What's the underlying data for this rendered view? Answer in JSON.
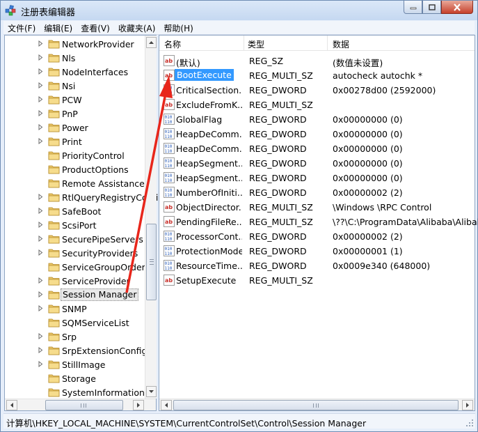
{
  "window": {
    "title": "注册表编辑器",
    "colors": {
      "titlebar": "#c5d8f1",
      "selection": "#3399ff",
      "annotation_arrow": "#e8261b"
    }
  },
  "menu": [
    {
      "label": "文件(F)"
    },
    {
      "label": "编辑(E)"
    },
    {
      "label": "查看(V)"
    },
    {
      "label": "收藏夹(A)"
    },
    {
      "label": "帮助(H)"
    }
  ],
  "tree": {
    "items": [
      {
        "label": "NetworkProvider",
        "expandable": true
      },
      {
        "label": "Nls",
        "expandable": true
      },
      {
        "label": "NodeInterfaces",
        "expandable": true
      },
      {
        "label": "Nsi",
        "expandable": true
      },
      {
        "label": "PCW",
        "expandable": true
      },
      {
        "label": "PnP",
        "expandable": true
      },
      {
        "label": "Power",
        "expandable": true
      },
      {
        "label": "Print",
        "expandable": true
      },
      {
        "label": "PriorityControl",
        "expandable": false
      },
      {
        "label": "ProductOptions",
        "expandable": false
      },
      {
        "label": "Remote Assistance",
        "expandable": false
      },
      {
        "label": "RtlQueryRegistryConfig",
        "expandable": true
      },
      {
        "label": "SafeBoot",
        "expandable": true
      },
      {
        "label": "ScsiPort",
        "expandable": true
      },
      {
        "label": "SecurePipeServers",
        "expandable": true
      },
      {
        "label": "SecurityProviders",
        "expandable": true
      },
      {
        "label": "ServiceGroupOrder",
        "expandable": false
      },
      {
        "label": "ServiceProvider",
        "expandable": true
      },
      {
        "label": "Session Manager",
        "expandable": true,
        "selected": true
      },
      {
        "label": "SNMP",
        "expandable": true
      },
      {
        "label": "SQMServiceList",
        "expandable": false
      },
      {
        "label": "Srp",
        "expandable": true
      },
      {
        "label": "SrpExtensionConfig",
        "expandable": true
      },
      {
        "label": "StillImage",
        "expandable": true
      },
      {
        "label": "Storage",
        "expandable": false
      },
      {
        "label": "SystemInformation",
        "expandable": false
      }
    ]
  },
  "list": {
    "columns": [
      "名称",
      "类型",
      "数据"
    ],
    "rows": [
      {
        "icon": "string-value-icon",
        "name": "(默认)",
        "type": "REG_SZ",
        "data": "(数值未设置)"
      },
      {
        "icon": "string-value-icon",
        "name": "BootExecute",
        "type": "REG_MULTI_SZ",
        "data": "autocheck autochk *",
        "selected": true
      },
      {
        "icon": "binary-value-icon",
        "name": "CriticalSection...",
        "type": "REG_DWORD",
        "data": "0x00278d00 (2592000)"
      },
      {
        "icon": "string-value-icon",
        "name": "ExcludeFromK...",
        "type": "REG_MULTI_SZ",
        "data": ""
      },
      {
        "icon": "binary-value-icon",
        "name": "GlobalFlag",
        "type": "REG_DWORD",
        "data": "0x00000000 (0)"
      },
      {
        "icon": "binary-value-icon",
        "name": "HeapDeComm...",
        "type": "REG_DWORD",
        "data": "0x00000000 (0)"
      },
      {
        "icon": "binary-value-icon",
        "name": "HeapDeComm...",
        "type": "REG_DWORD",
        "data": "0x00000000 (0)"
      },
      {
        "icon": "binary-value-icon",
        "name": "HeapSegment...",
        "type": "REG_DWORD",
        "data": "0x00000000 (0)"
      },
      {
        "icon": "binary-value-icon",
        "name": "HeapSegment...",
        "type": "REG_DWORD",
        "data": "0x00000000 (0)"
      },
      {
        "icon": "binary-value-icon",
        "name": "NumberOfIniti...",
        "type": "REG_DWORD",
        "data": "0x00000002 (2)"
      },
      {
        "icon": "string-value-icon",
        "name": "ObjectDirector...",
        "type": "REG_MULTI_SZ",
        "data": "\\Windows \\RPC Control"
      },
      {
        "icon": "string-value-icon",
        "name": "PendingFileRe...",
        "type": "REG_MULTI_SZ",
        "data": "\\??\\C:\\ProgramData\\Alibaba\\Alibal"
      },
      {
        "icon": "binary-value-icon",
        "name": "ProcessorCont...",
        "type": "REG_DWORD",
        "data": "0x00000002 (2)"
      },
      {
        "icon": "binary-value-icon",
        "name": "ProtectionMode",
        "type": "REG_DWORD",
        "data": "0x00000001 (1)"
      },
      {
        "icon": "binary-value-icon",
        "name": "ResourceTime...",
        "type": "REG_DWORD",
        "data": "0x0009e340 (648000)"
      },
      {
        "icon": "string-value-icon",
        "name": "SetupExecute",
        "type": "REG_MULTI_SZ",
        "data": ""
      }
    ]
  },
  "status": {
    "path": "计算机\\HKEY_LOCAL_MACHINE\\SYSTEM\\CurrentControlSet\\Control\\Session Manager"
  }
}
